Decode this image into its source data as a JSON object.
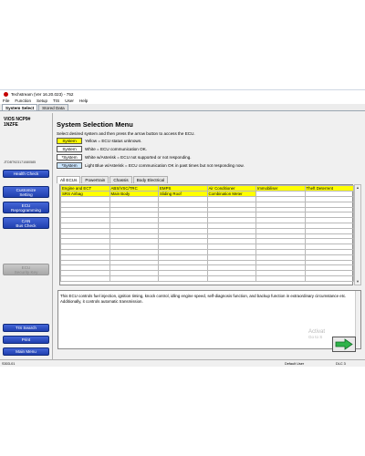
{
  "window": {
    "title": "Techstream (Ver 16.20.023) - 752",
    "menu": [
      "File",
      "Function",
      "Setup",
      "TIS",
      "User",
      "Help"
    ],
    "tabs": [
      "System Select",
      "Stored Data"
    ]
  },
  "sidebar": {
    "vehicle_model_line1": "VIOS NCP9#",
    "vehicle_model_line2": "1NZFE",
    "vin": "JTDBT923171080585",
    "buttons": {
      "health_check": "Health Check",
      "customize_line1": "Customize",
      "customize_line2": "Setting",
      "ecu_reprog_line1": "ECU",
      "ecu_reprog_line2": "Reprogramming",
      "can_line1": "CAN",
      "can_line2": "Bus Check",
      "ecu_security_line1": "ECU",
      "ecu_security_line2": "Security Key",
      "tis_search": "TIS Search",
      "print": "Print",
      "main_menu": "Main Menu"
    }
  },
  "main": {
    "title": "System Selection Menu",
    "instruction": "Select desired system and then press the arrow button to access the ECU.",
    "legend": [
      {
        "label": "System",
        "text": "Yellow = ECU status unknown.",
        "color": "#ffff00"
      },
      {
        "label": "System",
        "text": "White = ECU communication OK.",
        "color": "#ffffff"
      },
      {
        "label": "*System",
        "text": "White w/Asterisk = ECU not supported or not responding.",
        "color": "#ffffff"
      },
      {
        "label": "*System",
        "text": "Light Blue w/Asterisk = ECU communication OK in past times but not responding now.",
        "color": "#cce6ff"
      }
    ],
    "ecu_tabs": [
      "All ECUs",
      "Powertrain",
      "Chassis",
      "Body Electrical"
    ],
    "grid_rows": [
      [
        "Engine and ECT",
        "ABS/VSC/TRC",
        "EMPS",
        "Air Conditioner",
        "Immobiliser",
        "Theft Deterrent"
      ],
      [
        "SRS Airbag",
        "Main Body",
        "Sliding Roof",
        "Combination Meter",
        "",
        ""
      ]
    ],
    "description": "This ECU controls fuel injection, ignition timing, knock control, idling engine speed, self-diagnosis function, and backup function in extraordinary circumstance etc. Additionally, it controls automatic transmission."
  },
  "watermark": {
    "line1": "Activat",
    "line2": "Go to S"
  },
  "statusbar": {
    "left": "S303-01",
    "user": "Default User",
    "dlc": "DLC 3"
  },
  "colors": {
    "button_blue": "#2a4bc3",
    "highlight_yellow": "#ffff00"
  },
  "icons": {
    "app": "techstream-logo-icon",
    "next": "green-right-arrow-icon"
  }
}
